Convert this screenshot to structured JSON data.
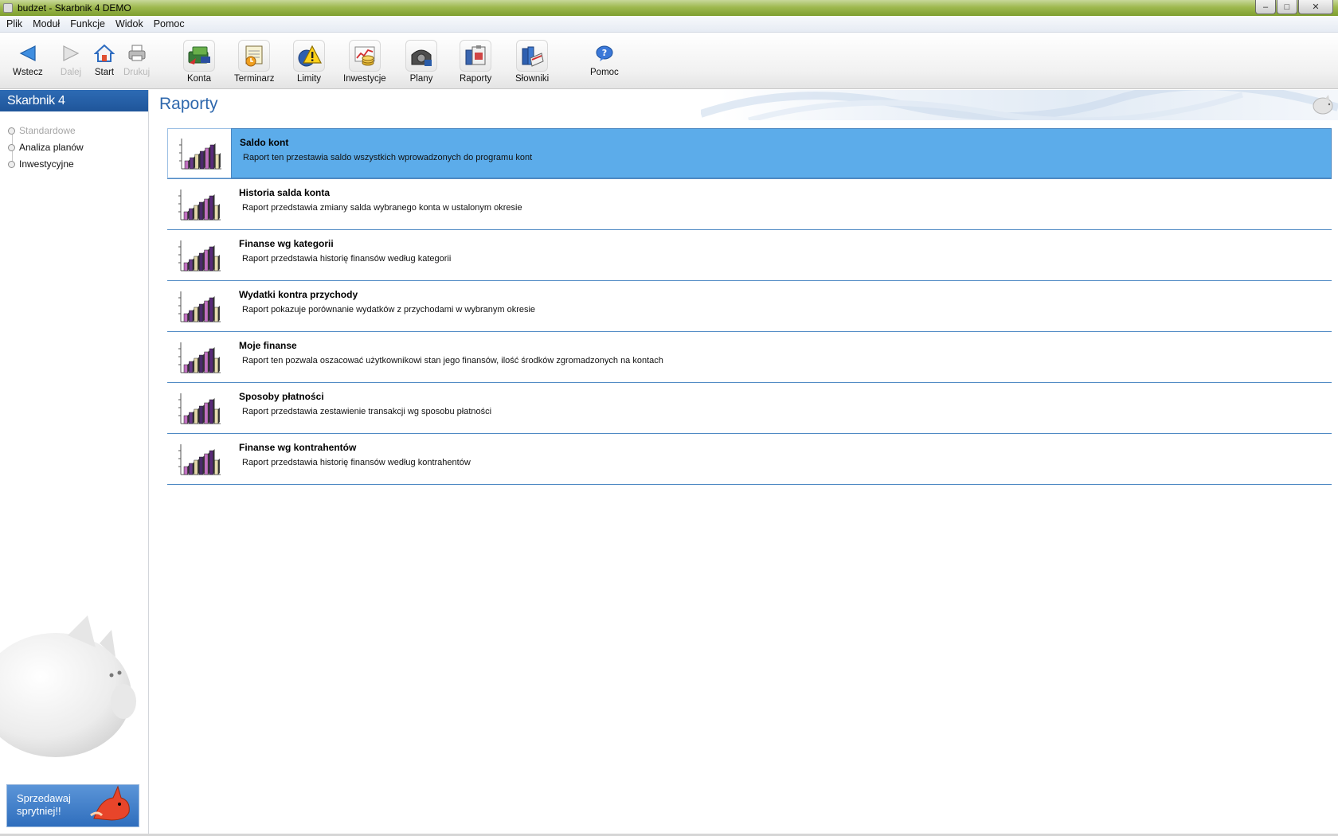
{
  "window": {
    "title": "budzet - Skarbnik 4 DEMO"
  },
  "menu": [
    "Plik",
    "Moduł",
    "Funkcje",
    "Widok",
    "Pomoc"
  ],
  "toolbar": {
    "back": "Wstecz",
    "forward": "Dalej",
    "start": "Start",
    "print": "Drukuj",
    "konta": "Konta",
    "terminarz": "Terminarz",
    "limity": "Limity",
    "inwestycje": "Inwestycje",
    "plany": "Plany",
    "raporty": "Raporty",
    "slowniki": "Słowniki",
    "pomoc": "Pomoc"
  },
  "sidebar": {
    "logo": "Skarbnik 4",
    "items": [
      {
        "label": "Standardowe",
        "state": "dimmed"
      },
      {
        "label": "Analiza planów",
        "state": "normal"
      },
      {
        "label": "Inwestycyjne",
        "state": "normal"
      }
    ],
    "promo": {
      "line1": "Sprzedawaj",
      "line2": "sprytniej!!"
    }
  },
  "main": {
    "title": "Raporty",
    "reports": [
      {
        "name": "Saldo kont",
        "desc": "Raport ten przestawia saldo wszystkich wprowadzonych do programu kont",
        "selected": true
      },
      {
        "name": "Historia salda konta",
        "desc": "Raport przedstawia zmiany salda wybranego konta w ustalonym okresie"
      },
      {
        "name": "Finanse wg kategorii",
        "desc": "Raport przedstawia historię finansów według kategorii"
      },
      {
        "name": "Wydatki kontra przychody",
        "desc": "Raport pokazuje porównanie wydatków z przychodami w wybranym okresie"
      },
      {
        "name": "Moje finanse",
        "desc": "Raport ten pozwala oszacować użytkownikowi stan jego finansów, ilość środków zgromadzonych na kontach"
      },
      {
        "name": "Sposoby płatności",
        "desc": "Raport przedstawia zestawienie transakcji wg sposobu płatności"
      },
      {
        "name": "Finanse wg kontrahentów",
        "desc": "Raport przedstawia historię finansów według kontrahentów"
      }
    ]
  },
  "colors": {
    "accent": "#2f68ad",
    "selection": "#5cacea",
    "divider": "#4f8ac4"
  }
}
